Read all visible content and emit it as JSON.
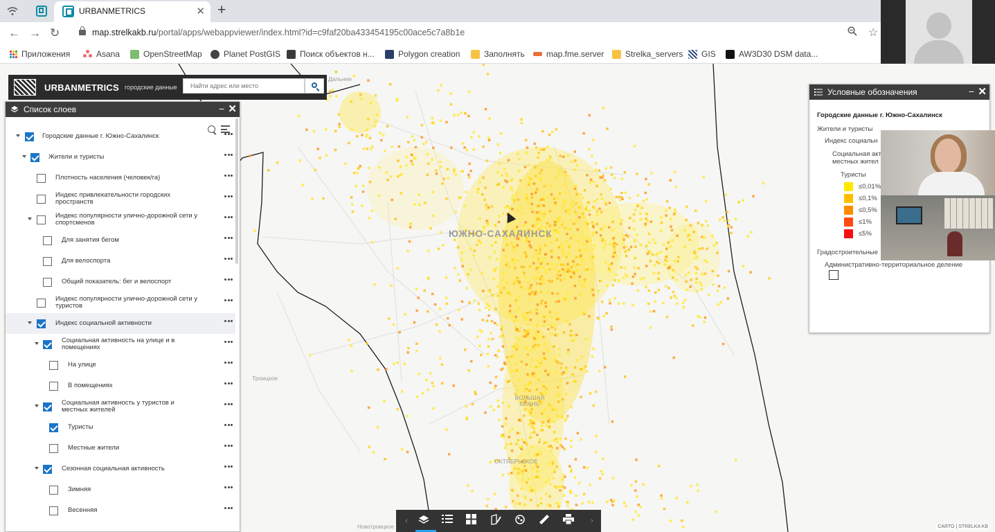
{
  "browser": {
    "tab_title": "URBANMETRICS",
    "url_host": "map.strelkakb.ru",
    "url_path": "/portal/apps/webappviewer/index.html?id=c9faf20ba433454195c00ace5c7a8b1e",
    "bookmarks": [
      "Приложения",
      "Asana",
      "OpenStreetMap",
      "Planet PostGIS",
      "Поиск объектов н...",
      "Polygon creation",
      "Заполнять",
      "map.fme.server",
      "Strelka_servers",
      "GIS",
      "AW3D30 DSM data..."
    ]
  },
  "app": {
    "brand_name": "URBANMETRICS",
    "brand_subtitle": "городские данные",
    "search_placeholder": "Найти адрес или место"
  },
  "layer_list": {
    "title": "Список слоев",
    "items": [
      {
        "label": "Городские данные г. Южно-Сахалинск",
        "checked": true,
        "expanded": true
      },
      {
        "label": "Жители и туристы",
        "checked": true,
        "expanded": true
      },
      {
        "label": "Плотность населения (человек/га)",
        "checked": false
      },
      {
        "label": "Индекс привлекательности городских пространств",
        "checked": false
      },
      {
        "label": "Индекс популярности улично-дорожной сети у спортсменов",
        "checked": false,
        "expanded": true
      },
      {
        "label": "Для занятия бегом",
        "checked": false
      },
      {
        "label": "Для велоспорта",
        "checked": false
      },
      {
        "label": "Общий показатель: бег и велоспорт",
        "checked": false
      },
      {
        "label": "Индекс популярности улично-дорожной сети у туристов",
        "checked": false
      },
      {
        "label": "Индекс социальной активности",
        "checked": true,
        "expanded": true
      },
      {
        "label": "Социальная активность на улице и в помещениях",
        "checked": true,
        "expanded": true
      },
      {
        "label": "На улице",
        "checked": false
      },
      {
        "label": "В помещениях",
        "checked": false
      },
      {
        "label": "Социальная активность у туристов и местных жителей",
        "checked": true,
        "expanded": true
      },
      {
        "label": "Туристы",
        "checked": true
      },
      {
        "label": "Местные жители",
        "checked": false
      },
      {
        "label": "Сезонная социальная активность",
        "checked": true,
        "expanded": true
      },
      {
        "label": "Зимняя",
        "checked": false
      },
      {
        "label": "Весенняя",
        "checked": false
      }
    ]
  },
  "legend": {
    "title": "Условные обозначения",
    "group_title": "Городские данные г. Южно-Сахалинск",
    "level1": "Жители и туристы",
    "level2": "Индекс социальн",
    "level3a": "Социальная акт",
    "level3b": "местных жител",
    "series_title": "Туристы",
    "classes": [
      {
        "label": "≤0,01%",
        "color": "#ffe800"
      },
      {
        "label": "≤0,1%",
        "color": "#ffbf00"
      },
      {
        "label": "≤0,5%",
        "color": "#ff8c00"
      },
      {
        "label": "≤1%",
        "color": "#ff4a12"
      },
      {
        "label": "≤5%",
        "color": "#f21111"
      }
    ],
    "group2_title": "Градостроительные",
    "admin_label": "Административно-территориальное деление"
  },
  "map": {
    "city_label": "ЮЖНО-САХАЛИНСК",
    "place_labels": {
      "dalnee": "Дальнее",
      "troitskoe": "Троицкое",
      "bolshaya_elan": "БОЛЬШАЯ ЕЛАНЬ",
      "oktyabrskoe": "ОКТЯБРЬСКОЕ",
      "novotroitskoe": "Новотроицкое"
    },
    "attribution": "CARTO | STRELKA KB"
  },
  "widgets": [
    "layers-icon",
    "legend-icon",
    "basemap-icon",
    "draw-icon",
    "analysis-icon",
    "measure-icon",
    "print-icon"
  ]
}
